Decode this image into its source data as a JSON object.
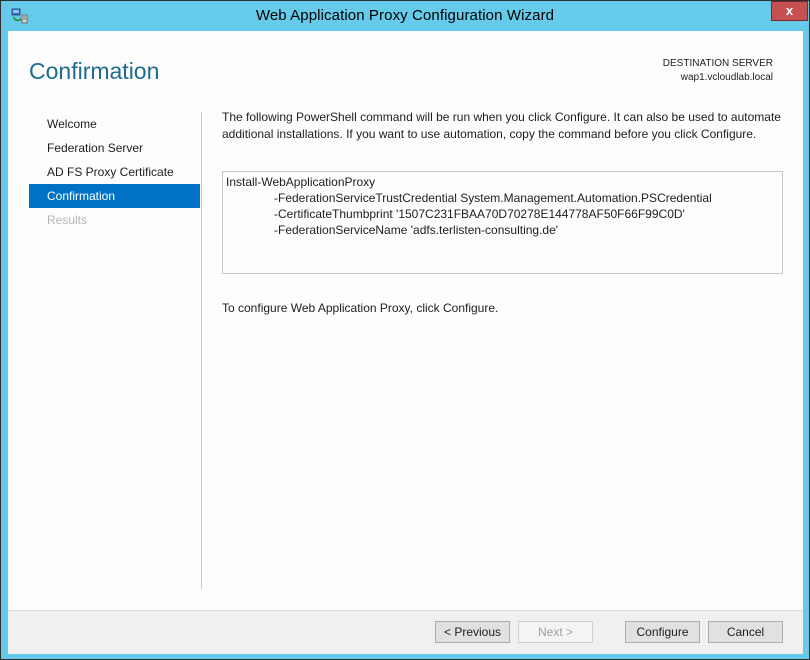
{
  "window": {
    "title": "Web Application Proxy Configuration Wizard",
    "close_label": "x",
    "icon": "server-network-icon"
  },
  "header": {
    "page_title": "Confirmation",
    "destination_label": "DESTINATION SERVER",
    "destination_value": "wap1.vcloudlab.local"
  },
  "nav": {
    "items": [
      {
        "label": "Welcome",
        "state": "normal"
      },
      {
        "label": "Federation Server",
        "state": "normal"
      },
      {
        "label": "AD FS Proxy Certificate",
        "state": "normal"
      },
      {
        "label": "Confirmation",
        "state": "active"
      },
      {
        "label": "Results",
        "state": "disabled"
      }
    ]
  },
  "main": {
    "description": "The following PowerShell command will be run when you click Configure. It can also be used to automate additional installations. If you want to use automation, copy the command before you click Configure.",
    "command_lines": [
      "Install-WebApplicationProxy",
      "-FederationServiceTrustCredential System.Management.Automation.PSCredential",
      "-CertificateThumbprint '1507C231FBAA70D70278E144778AF50F66F99C0D'",
      "-FederationServiceName 'adfs.terlisten-consulting.de'"
    ],
    "hint": "To configure Web Application Proxy, click Configure."
  },
  "footer": {
    "previous_label": "< Previous",
    "next_label": "Next >",
    "configure_label": "Configure",
    "cancel_label": "Cancel"
  },
  "colors": {
    "frame": "#66cbea",
    "accent": "#0072c6",
    "title_text": "#1e6b8f",
    "close": "#c75050"
  }
}
